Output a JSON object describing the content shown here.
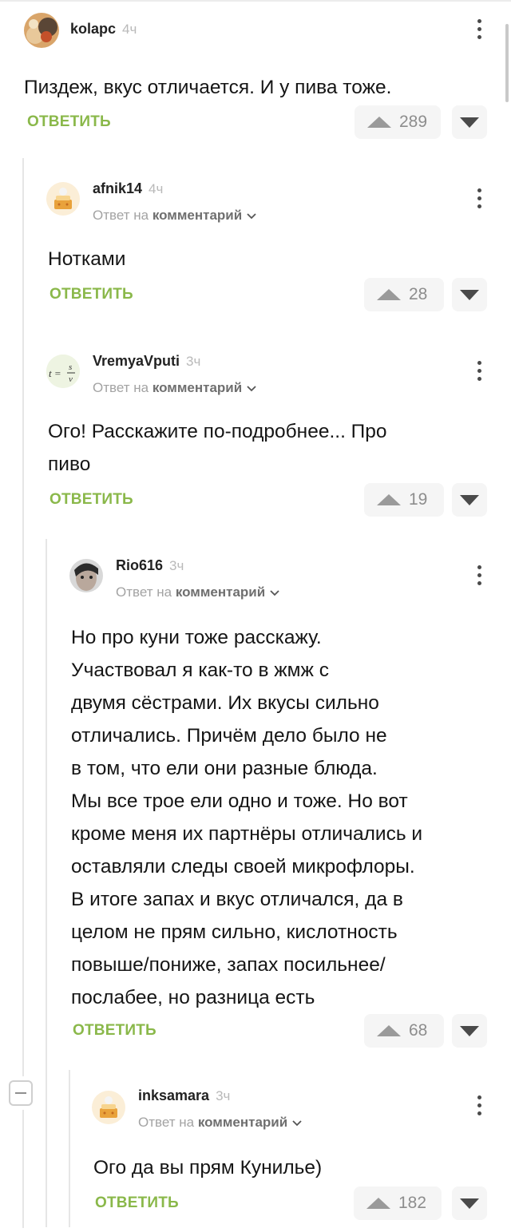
{
  "labels": {
    "reply": "ОТВЕТИТЬ",
    "reply_to_prefix": "Ответ на",
    "reply_to_target": "комментарий"
  },
  "comments": [
    {
      "username": "kolapc",
      "time": "4ч",
      "text": "Пиздеж, вкус отличается. И у пива тоже.",
      "rating": "289",
      "avatar_icon": "user-photo-avatar"
    },
    {
      "username": "afnik14",
      "time": "4ч",
      "text": "Нотками",
      "rating": "28",
      "avatar_icon": "default-cake-avatar"
    },
    {
      "username": "VremyaVputi",
      "time": "3ч",
      "text": "Ого! Расскажите по-подробнее... Про\nпиво",
      "rating": "19",
      "avatar_icon": "formula-avatar",
      "avatar_text": "t = s/v"
    },
    {
      "username": "Rio616",
      "time": "3ч",
      "text": "Но про куни тоже расскажу.\nУчаствовал я как-то в жмж с\nдвумя сёстрами. Их вкусы сильно\nотличались. Причём дело было не\nв том, что ели они разные блюда.\nМы все трое ели одно и тоже. Но вот\nкроме меня их партнёры отличались и\nоставляли следы своей микрофлоры.\nВ итоге запах и вкус отличался, да в\nцелом не прям сильно, кислотность\nповыше/пониже, запах посильнее/\nпослабее, но разница есть",
      "rating": "68",
      "avatar_icon": "user-photo-avatar"
    },
    {
      "username": "inksamara",
      "time": "3ч",
      "text": "Ого да вы прям Кунилье)",
      "rating": "182",
      "avatar_icon": "default-cake-avatar"
    }
  ],
  "colors": {
    "reply_green": "#8ab84a",
    "thread_line": "#e6e6e6",
    "vote_bg": "#f5f5f5",
    "muted_text": "#a3a3a3"
  }
}
